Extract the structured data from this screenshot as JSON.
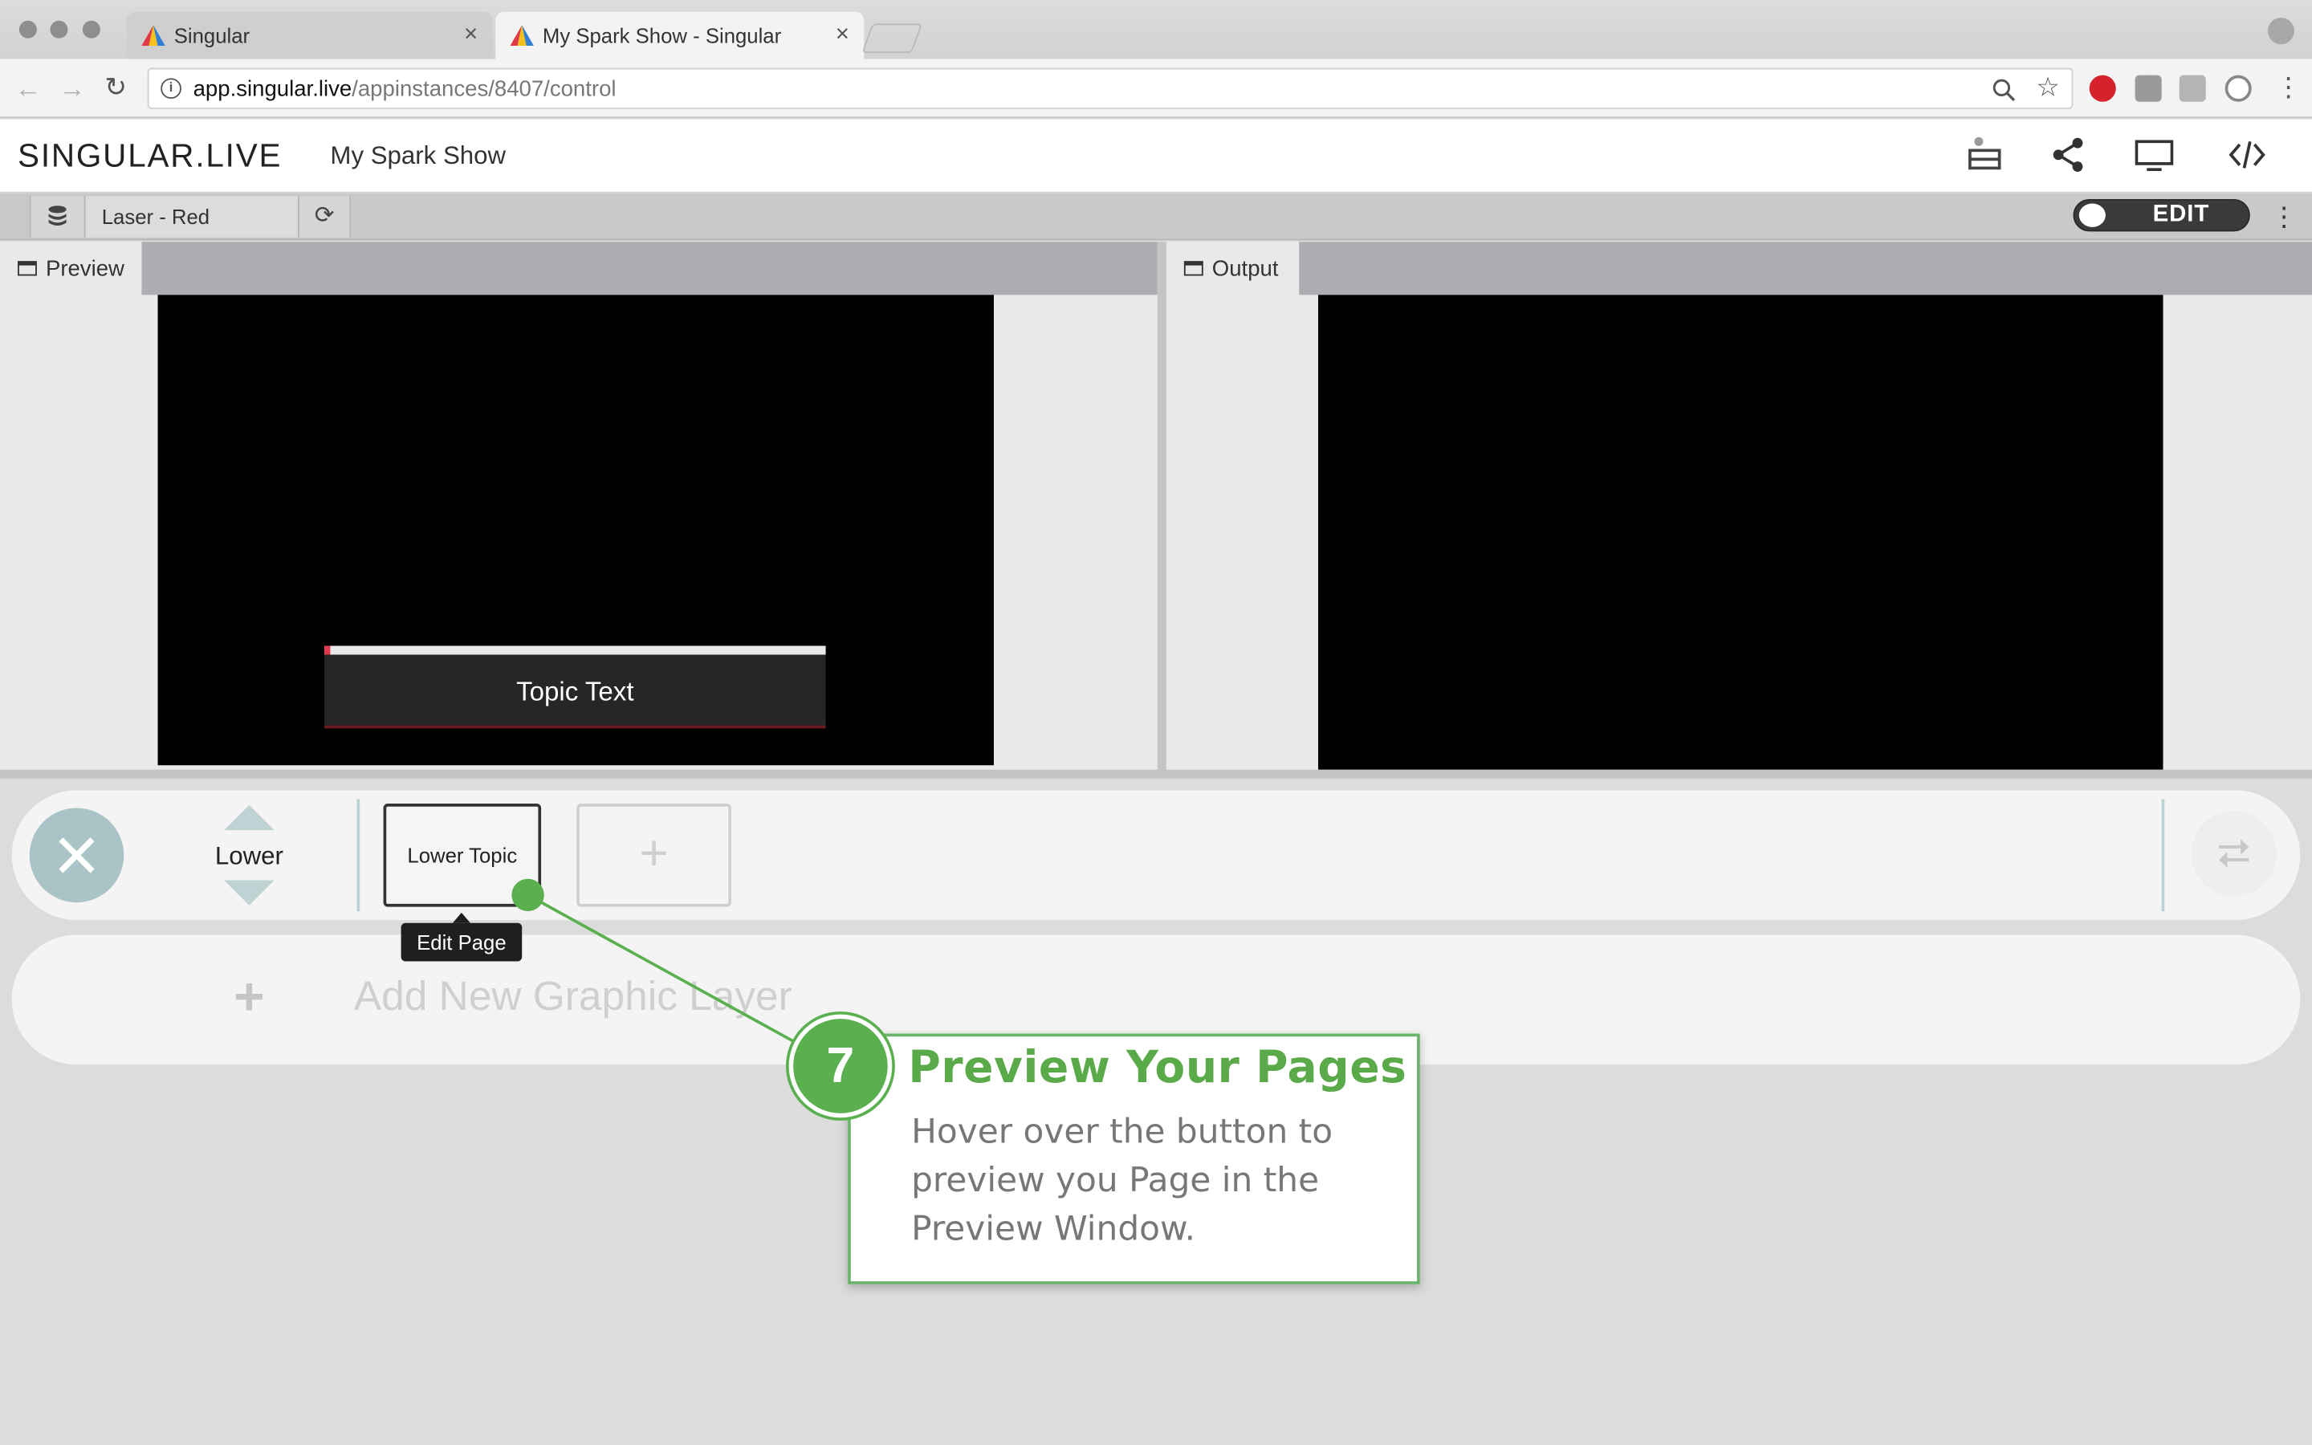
{
  "browser": {
    "tabs": [
      {
        "title": "Singular",
        "close": "×",
        "active": false
      },
      {
        "title": "My Spark Show - Singular",
        "close": "×",
        "active": true
      }
    ],
    "url_host": "app.singular.live",
    "url_path": "/appinstances/8407/control"
  },
  "app": {
    "logo": "SINGULAR.LIVE",
    "show_title": "My Spark Show"
  },
  "toolbar": {
    "data_source": "Laser - Red",
    "edit_label": "EDIT"
  },
  "panels": {
    "preview_label": "Preview",
    "output_label": "Output",
    "lower_third_text": "Topic Text"
  },
  "layer": {
    "name": "Lower",
    "page_button_label": "Lower Topic",
    "add_page_symbol": "+",
    "tooltip": "Edit Page"
  },
  "add_layer": {
    "symbol": "+",
    "label": "Add New Graphic Layer"
  },
  "callout": {
    "step": "7",
    "title": "Preview Your Pages",
    "text": "Hover over the button to preview you Page in the Preview Window."
  },
  "colors": {
    "accent_green": "#5aaf4f",
    "logo_a_red": "#e03a4a",
    "logo_a_yellow": "#f2c21b",
    "logo_a_blue": "#2f7fd6"
  }
}
